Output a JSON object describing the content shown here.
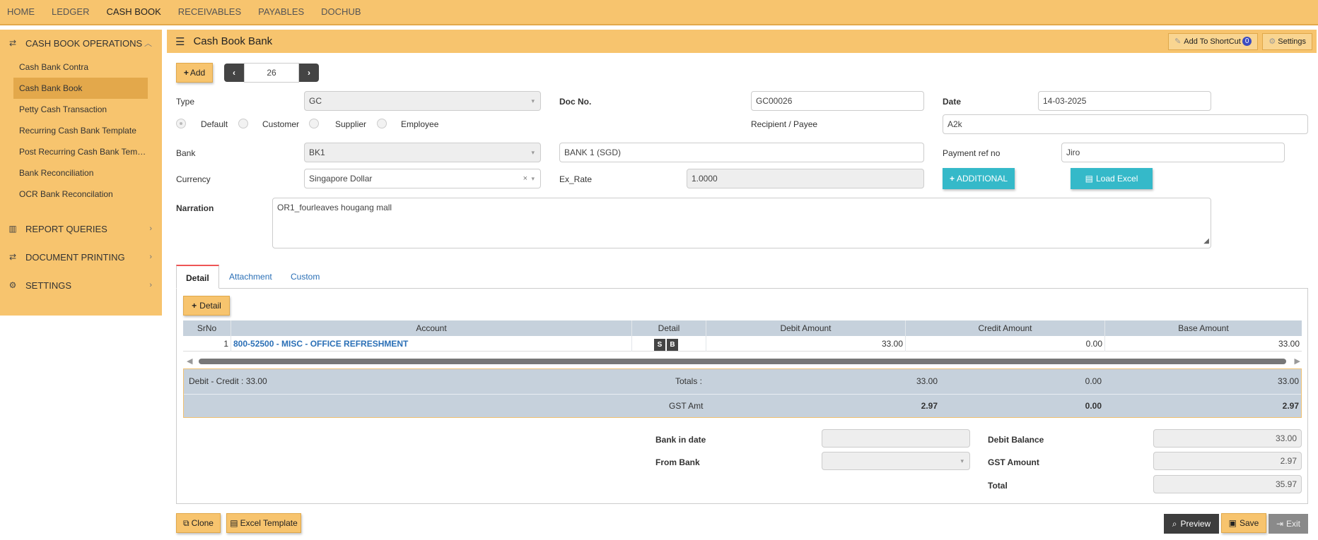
{
  "topnav": {
    "items": [
      {
        "label": "HOME"
      },
      {
        "label": "LEDGER"
      },
      {
        "label": "CASH BOOK"
      },
      {
        "label": "RECEIVABLES"
      },
      {
        "label": "PAYABLES"
      },
      {
        "label": "DOCHUB"
      }
    ],
    "active": "CASH BOOK"
  },
  "sidebar": {
    "sections": [
      {
        "label": "CASH BOOK OPERATIONS",
        "icon": "exchange-icon",
        "expanded": true
      },
      {
        "label": "REPORT QUERIES",
        "icon": "bar-chart-icon"
      },
      {
        "label": "DOCUMENT PRINTING",
        "icon": "exchange-icon"
      },
      {
        "label": "SETTINGS",
        "icon": "gears-icon"
      }
    ],
    "items": [
      {
        "label": "Cash Bank Contra"
      },
      {
        "label": "Cash Bank Book"
      },
      {
        "label": "Petty Cash Transaction"
      },
      {
        "label": "Recurring Cash Bank Template"
      },
      {
        "label": "Post Recurring Cash Bank Templ..."
      },
      {
        "label": "Bank Reconciliation"
      },
      {
        "label": "OCR Bank Reconcilation"
      }
    ],
    "active_item": "Cash Bank Book"
  },
  "header": {
    "title": "Cash Book Bank",
    "shortcut_label": "Add To ShortCut",
    "shortcut_count": "0",
    "settings_label": "Settings"
  },
  "toolbar": {
    "add_label": "Add",
    "record_number": "26"
  },
  "form": {
    "type_label": "Type",
    "type_value": "GC",
    "doc_no_label": "Doc No.",
    "doc_no_value": "GC00026",
    "date_label": "Date",
    "date_value": "14-03-2025",
    "radios": [
      {
        "label": "Default",
        "selected": true
      },
      {
        "label": "Customer",
        "selected": false
      },
      {
        "label": "Supplier",
        "selected": false
      },
      {
        "label": "Employee",
        "selected": false
      }
    ],
    "recipient_label": "Recipient / Payee",
    "recipient_value": "A2k",
    "bank_label": "Bank",
    "bank_code": "BK1",
    "bank_name": "BANK 1 (SGD)",
    "payment_ref_label": "Payment ref no",
    "payment_ref_value": "Jiro",
    "currency_label": "Currency",
    "currency_value": "Singapore Dollar",
    "ex_rate_label": "Ex_Rate",
    "ex_rate_value": "1.0000",
    "additional_label": "ADDITIONAL",
    "load_excel_label": "Load Excel",
    "narration_label": "Narration",
    "narration_value": "OR1_fourleaves hougang mall"
  },
  "tabs": [
    {
      "label": "Detail",
      "active": true
    },
    {
      "label": "Attachment"
    },
    {
      "label": "Custom"
    }
  ],
  "detail": {
    "add_label": "Detail",
    "columns": [
      "SrNo",
      "Account",
      "Detail",
      "Debit Amount",
      "Credit Amount",
      "Base Amount"
    ],
    "rows": [
      {
        "srno": "1",
        "account": "800-52500 - MISC - OFFICE REFRESHMENT",
        "detail_s": "S",
        "detail_b": "B",
        "debit": "33.00",
        "credit": "0.00",
        "base": "33.00"
      }
    ],
    "summary": {
      "debit_credit": "Debit - Credit : 33.00",
      "totals_label": "Totals :",
      "totals_debit": "33.00",
      "totals_credit": "0.00",
      "totals_base": "33.00",
      "gst_label": "GST Amt",
      "gst_debit": "2.97",
      "gst_credit": "0.00",
      "gst_base": "2.97"
    }
  },
  "bottom": {
    "bank_in_date_label": "Bank in date",
    "bank_in_date_value": "",
    "from_bank_label": "From Bank",
    "from_bank_value": "",
    "debit_balance_label": "Debit Balance",
    "debit_balance_value": "33.00",
    "gst_amount_label": "GST Amount",
    "gst_amount_value": "2.97",
    "total_label": "Total",
    "total_value": "35.97"
  },
  "footer": {
    "clone_label": "Clone",
    "excel_template_label": "Excel Template",
    "preview_label": "Preview",
    "save_label": "Save",
    "exit_label": "Exit"
  },
  "colors": {
    "accent": "#f7c46e",
    "accent_dark": "#e3a84b",
    "teal": "#35b9c9",
    "grid_header": "#c6d1dc",
    "link": "#2a6fb6"
  }
}
